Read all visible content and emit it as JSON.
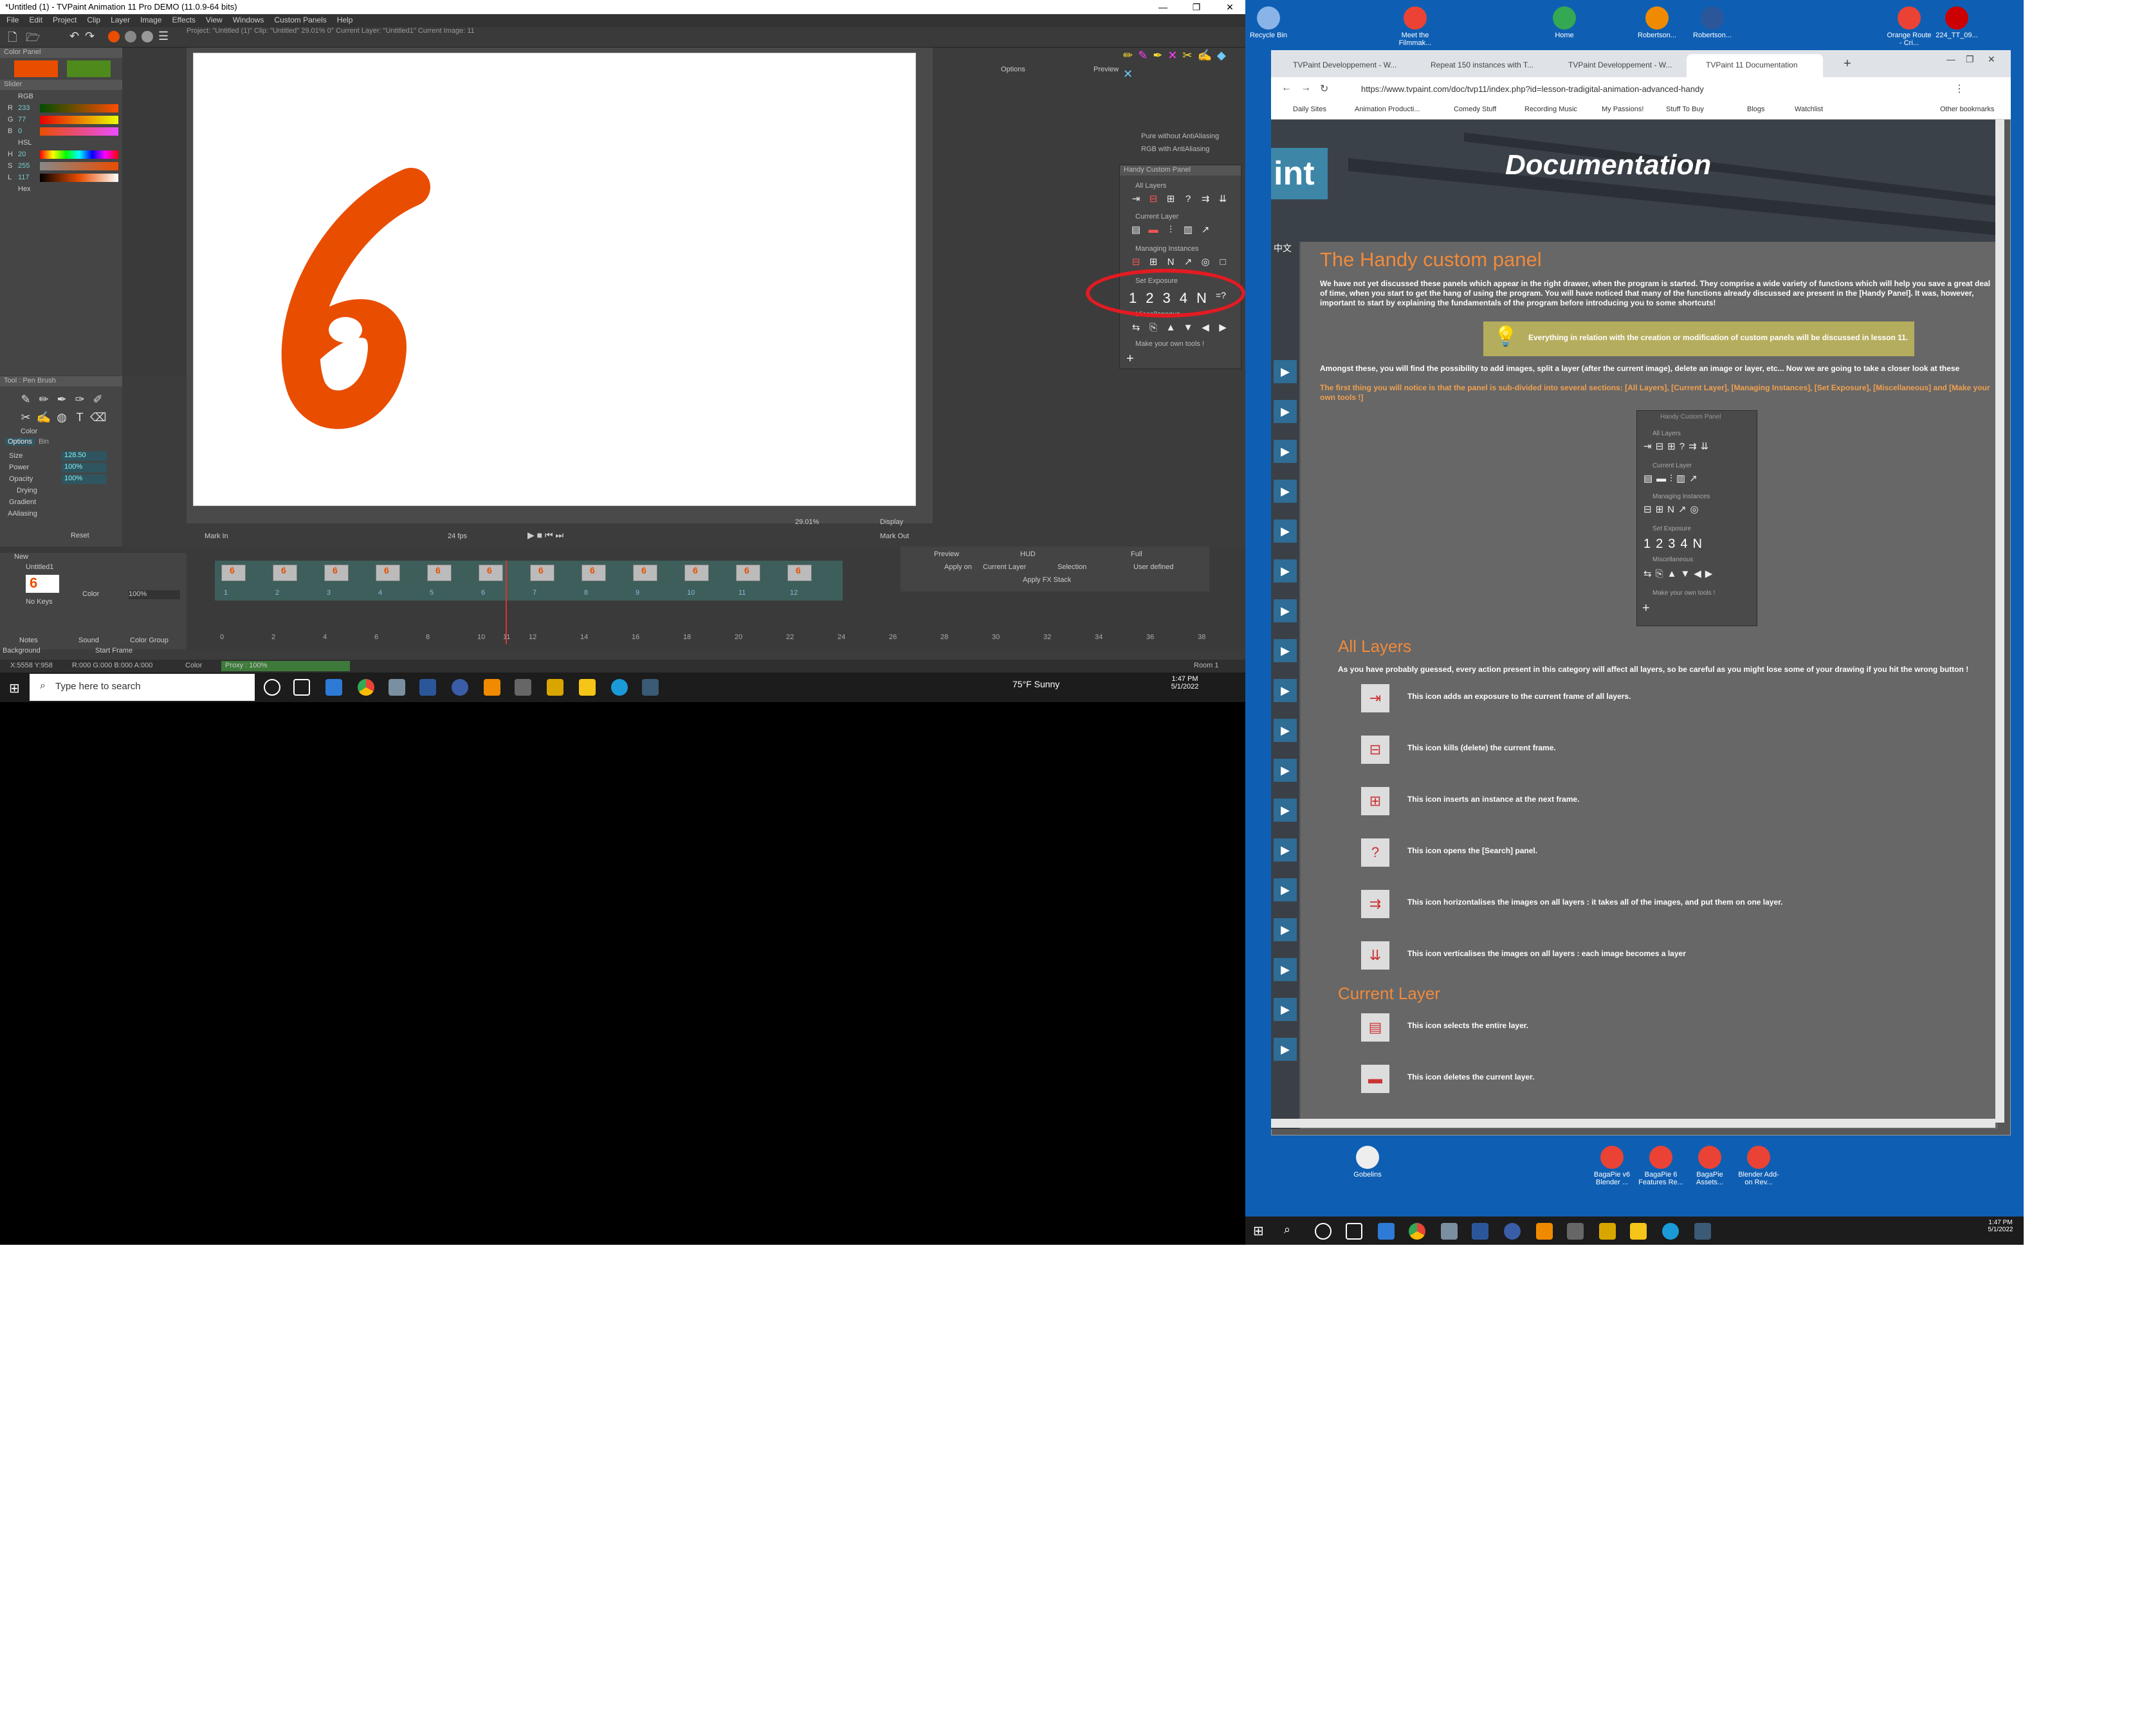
{
  "tvpaint": {
    "title": "*Untitled (1) - TVPaint Animation 11 Pro DEMO (11.0.9-64 bits)",
    "menu": [
      "File",
      "Edit",
      "Project",
      "Clip",
      "Layer",
      "Image",
      "Effects",
      "View",
      "Windows",
      "Custom Panels",
      "Help"
    ],
    "info": "Project: \"Untitled (1)\"  Clip: \"Untitled\"  29.01%  0°  Current Layer: \"Untitled1\"  Current Image: 11",
    "color_panel_header": "Color Panel",
    "slider_header": "Slider",
    "channels": [
      {
        "label": "R",
        "value": "233"
      },
      {
        "label": "G",
        "value": "77"
      },
      {
        "label": "B",
        "value": "0"
      },
      {
        "label": "H",
        "value": "20"
      },
      {
        "label": "S",
        "value": "255"
      },
      {
        "label": "L",
        "value": "117"
      }
    ],
    "rgb_label": "RGB",
    "hsl_label": "HSL",
    "hex_label": "Hex",
    "tool_header": "Tool : Pen Brush",
    "color_label": "Color",
    "options_tab": "Options",
    "bin_tab": "Bin",
    "options": [
      {
        "label": "Size",
        "value": "128.50"
      },
      {
        "label": "Power",
        "value": "100%"
      },
      {
        "label": "Opacity",
        "value": "100%"
      }
    ],
    "drying_label": "Drying",
    "gradient_label": "Gradient",
    "aaliasing_label": "AAliasing",
    "reset_label": "Reset",
    "canvas_digit": "6",
    "zoom": "29.01%",
    "display_label": "Display",
    "options_label": "Options",
    "preview_label": "Preview",
    "handy_panel": {
      "title": "Handy Custom Panel",
      "sections": [
        "All Layers",
        "Current Layer",
        "Managing Instances",
        "Set Exposure",
        "Miscellaneous",
        "Make your own tools !"
      ],
      "exposure": [
        "1",
        "2",
        "3",
        "4",
        "N",
        "=?"
      ],
      "pure_aa": "Pure without AntiAliasing",
      "rgb_aa": "RGB with AntiAliasing"
    },
    "timeline": {
      "mark_in": "Mark In",
      "mark_out": "Mark Out",
      "fps": "24 fps",
      "layer_name": "Untitled1",
      "new_label": "New",
      "no_keys": "No Keys",
      "color_label": "Color",
      "opacity": "100%",
      "frames": [
        "1",
        "2",
        "3",
        "4",
        "5",
        "6",
        "7",
        "8",
        "9",
        "10",
        "11",
        "12"
      ],
      "ruler": [
        "0",
        "2",
        "4",
        "6",
        "8",
        "10",
        "11",
        "12",
        "14",
        "16",
        "18",
        "20",
        "22",
        "24",
        "26",
        "28",
        "30",
        "32",
        "34",
        "36",
        "38"
      ],
      "notes": "Notes",
      "sound": "Sound",
      "color_group": "Color Group",
      "background": "Background",
      "start_frame": "Start Frame"
    },
    "fx": {
      "preview": "Preview",
      "hud": "HUD",
      "full": "Full",
      "apply_on": "Apply on",
      "current_layer": "Current Layer",
      "selection": "Selection",
      "user_defined": "User defined",
      "apply_fx": "Apply FX Stack"
    },
    "status": {
      "coords": "X:5558  Y:958",
      "rgba": "R:000 G:000 B:000 A:000",
      "color": "Color",
      "proxy": "Proxy : 100%",
      "room": "Room 1"
    }
  },
  "taskbar1": {
    "search_placeholder": "Type here to search",
    "weather": "75°F  Sunny",
    "time": "1:47 PM",
    "date": "5/1/2022"
  },
  "desktop2": {
    "icons": [
      {
        "label": "Recycle Bin"
      },
      {
        "label": "Meet the Filmmak..."
      },
      {
        "label": "Home"
      },
      {
        "label": "Robertson..."
      },
      {
        "label": "Robertson..."
      },
      {
        "label": "Orange Route - Cri..."
      },
      {
        "label": "224_TT_09..."
      },
      {
        "label": "Gobelins"
      },
      {
        "label": "BagaPie v6 Blender ..."
      },
      {
        "label": "BagaPie 6 Features Re..."
      },
      {
        "label": "BagaPie Assets..."
      },
      {
        "label": "Blender Add-on Rev..."
      }
    ],
    "time": "1:47 PM",
    "date": "5/1/2022"
  },
  "chrome": {
    "tabs": [
      "TVPaint Developpement - W...",
      "Repeat 150 instances with T...",
      "TVPaint Developpement - W...",
      "TVPaint 11 Documentation"
    ],
    "url": "https://www.tvpaint.com/doc/tvp11/index.php?id=lesson-tradigital-animation-advanced-handy",
    "bookmarks": [
      "Daily Sites",
      "Animation Producti...",
      "Comedy Stuff",
      "Recording Music",
      "My Passions!",
      "Stuff To Buy",
      "Blogs",
      "Watchlist",
      "Other bookmarks"
    ]
  },
  "doc": {
    "banner_title": "Documentation",
    "logo": "int",
    "lang": "中文",
    "heading": "The Handy custom panel",
    "intro": "We have not yet discussed these panels which appear in the right drawer, when the program is started. They comprise a wide variety of functions which will help you save a great deal of time, when you start to get the hang of using the program. You will have noticed that many of the functions already discussed are present in the [Handy Panel]. It was, however, important to start by explaining the fundamentals of the program before introducing you to some shortcuts!",
    "tip": "Everything in relation with the creation or modification of custom panels will be discussed in lesson 11.",
    "para2": "Amongst these, you will find the possibility to add images, split a layer (after the current image), delete an image or layer, etc... Now we are going to take a closer look at these functions.",
    "para3": "The first thing you will notice is that the panel is sub-divided into several sections: [All Layers], [Current Layer], [Managing Instances], [Set Exposure], [Miscellaneous] and [Make your own tools !]",
    "all_layers_heading": "All Layers",
    "all_layers_intro": "As you have probably guessed, every action present in this category will affect all layers, so be careful as you might lose some of your drawing if you hit the wrong button !",
    "rows": [
      "This icon adds an exposure to the current frame of all layers.",
      "This icon kills (delete) the current frame.",
      "This icon inserts an instance at the next frame.",
      "This icon opens the [Search] panel.",
      "This icon horizontalises the images on all layers : it takes all of the images, and put them on one layer.",
      "This icon verticalises the images on all layers : each image becomes a layer"
    ],
    "current_layer_heading": "Current Layer",
    "cl_rows": [
      "This icon selects the entire layer.",
      "This icon deletes the current layer."
    ],
    "colors": {
      "accent": "#f08a3c",
      "circle": "#e21b22",
      "paint": "#e94d00"
    }
  }
}
